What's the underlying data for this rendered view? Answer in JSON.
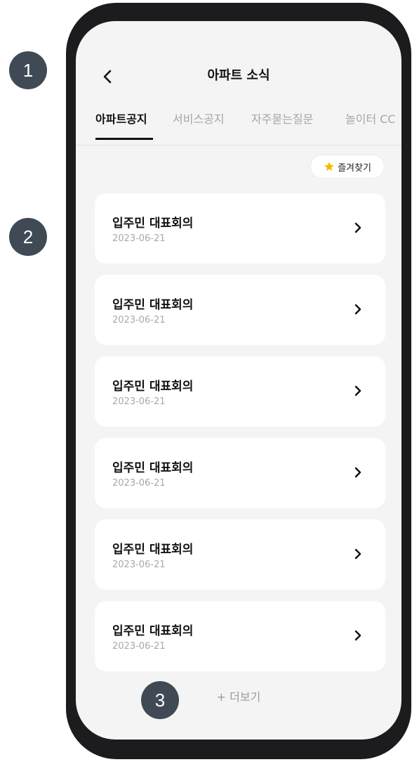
{
  "markers": [
    "1",
    "2",
    "3"
  ],
  "header": {
    "title": "아파트 소식",
    "back_icon": "chevron-left-icon"
  },
  "tabs": [
    {
      "label": "아파트공지",
      "active": true
    },
    {
      "label": "서비스공지",
      "active": false
    },
    {
      "label": "자주묻는질문",
      "active": false
    },
    {
      "label": "놀이터 CC",
      "active": false
    }
  ],
  "favorite": {
    "label": "즐겨찾기",
    "icon": "star-icon",
    "icon_color": "#f5b800"
  },
  "notices": [
    {
      "title": "입주민 대표회의",
      "date": "2023-06-21"
    },
    {
      "title": "입주민 대표회의",
      "date": "2023-06-21"
    },
    {
      "title": "입주민 대표회의",
      "date": "2023-06-21"
    },
    {
      "title": "입주민 대표회의",
      "date": "2023-06-21"
    },
    {
      "title": "입주민 대표회의",
      "date": "2023-06-21"
    },
    {
      "title": "입주민 대표회의",
      "date": "2023-06-21"
    }
  ],
  "more": {
    "label": "+ 더보기"
  }
}
